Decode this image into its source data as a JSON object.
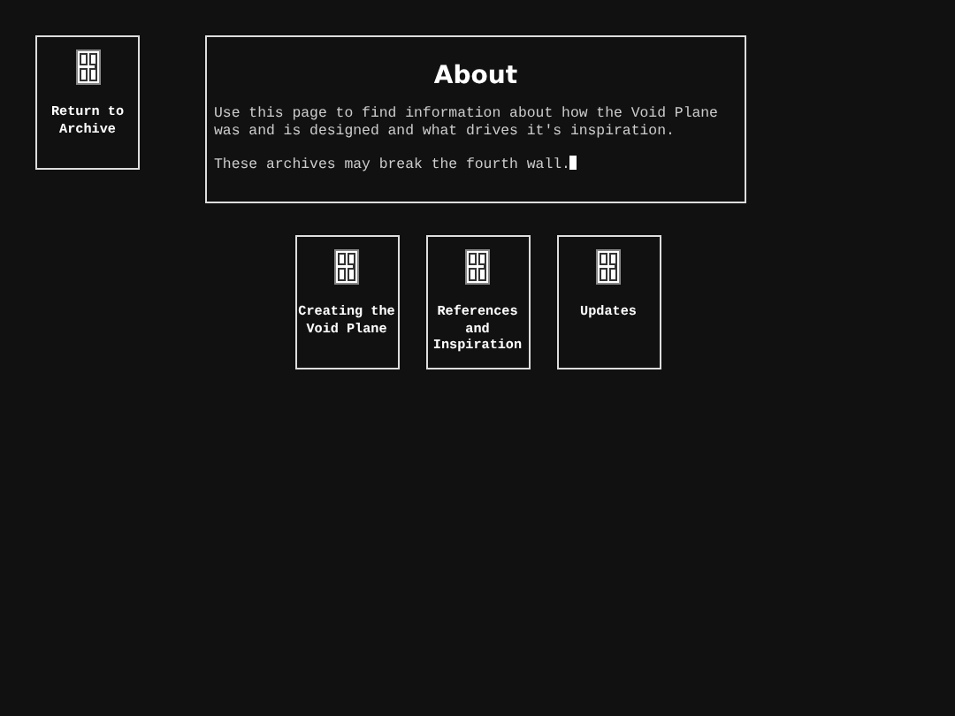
{
  "back_link": {
    "label": "Return to Archive"
  },
  "about": {
    "title": "About",
    "paragraphs": [
      "Use this page to find information about how the Void Plane was and is designed and what drives it's inspiration.",
      "These archives may break the fourth wall."
    ]
  },
  "links": [
    {
      "label": "Creating the Void Plane"
    },
    {
      "label": "References and Inspiration"
    },
    {
      "label": "Updates"
    }
  ]
}
